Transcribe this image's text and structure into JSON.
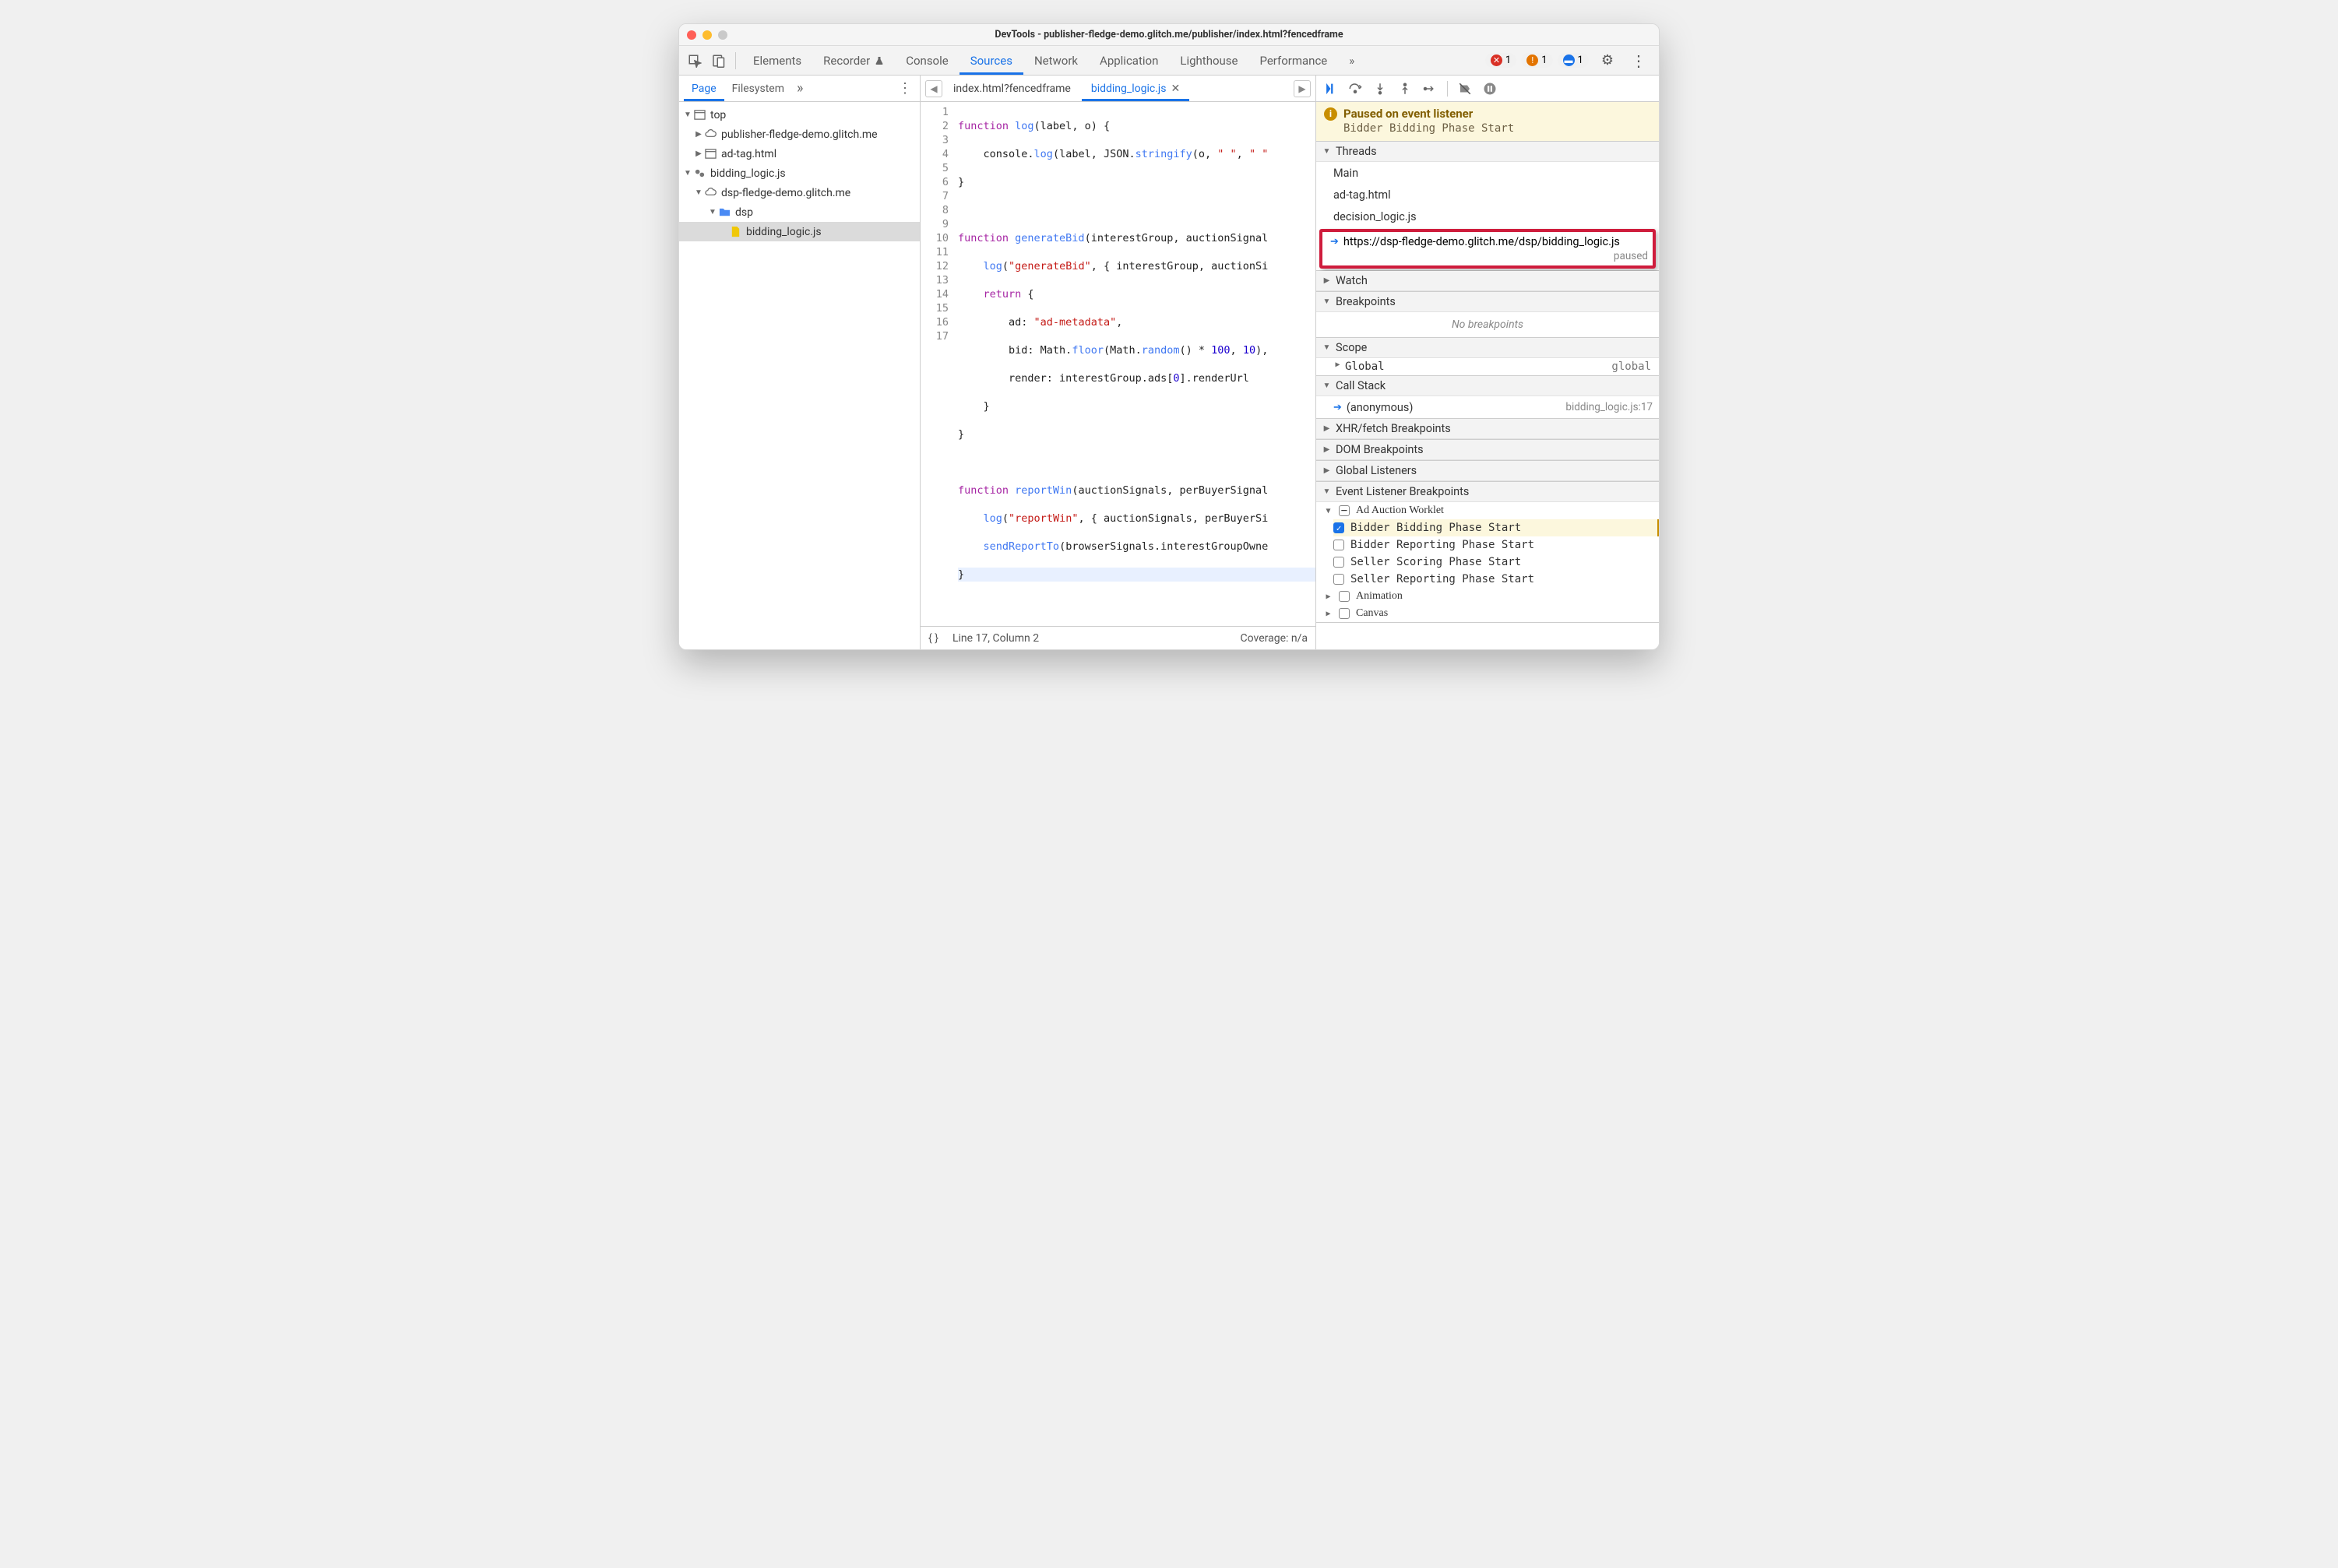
{
  "title": "DevTools - publisher-fledge-demo.glitch.me/publisher/index.html?fencedframe",
  "main_tabs": [
    "Elements",
    "Recorder",
    "Console",
    "Sources",
    "Network",
    "Application",
    "Lighthouse",
    "Performance"
  ],
  "main_active": "Sources",
  "counts": {
    "errors": "1",
    "warnings": "1",
    "messages": "1"
  },
  "left_tabs": [
    "Page",
    "Filesystem"
  ],
  "left_active": "Page",
  "tree": {
    "top": "top",
    "pub": "publisher-fledge-demo.glitch.me",
    "adtag": "ad-tag.html",
    "bidding": "bidding_logic.js",
    "dspcloud": "dsp-fledge-demo.glitch.me",
    "dspfolder": "dsp",
    "bidfile": "bidding_logic.js"
  },
  "file_tabs": [
    "index.html?fencedframe",
    "bidding_logic.js"
  ],
  "file_active": "bidding_logic.js",
  "code": {
    "l1": {
      "a": "function ",
      "b": "log",
      "c": "(label, o) {"
    },
    "l2": {
      "a": "    console.",
      "b": "log",
      "c": "(label, JSON.",
      "d": "stringify",
      "e": "(o, ",
      "f": "\" \"",
      "g": ", ",
      "h": "\" \""
    },
    "l3": "}",
    "l5": {
      "a": "function ",
      "b": "generateBid",
      "c": "(interestGroup, auctionSignal"
    },
    "l6": {
      "a": "    ",
      "b": "log",
      "c": "(",
      "d": "\"generateBid\"",
      "e": ", { interestGroup, auctionSi"
    },
    "l7": {
      "a": "    ",
      "b": "return ",
      "c": "{"
    },
    "l8": {
      "a": "        ad: ",
      "b": "\"ad-metadata\"",
      "c": ","
    },
    "l9": {
      "a": "        bid: Math.",
      "b": "floor",
      "c": "(Math.",
      "d": "random",
      "e": "() * ",
      "f": "100",
      "g": ", ",
      "h": "10",
      "i": "),"
    },
    "l10": {
      "a": "        render: interestGroup.ads[",
      "b": "0",
      "c": "].renderUrl"
    },
    "l11": "    }",
    "l12": "}",
    "l14": {
      "a": "function ",
      "b": "reportWin",
      "c": "(auctionSignals, perBuyerSignal"
    },
    "l15": {
      "a": "    ",
      "b": "log",
      "c": "(",
      "d": "\"reportWin\"",
      "e": ", { auctionSignals, perBuyerSi"
    },
    "l16": {
      "a": "    ",
      "b": "sendReportTo",
      "c": "(browserSignals.interestGroupOwne"
    },
    "l17": "}"
  },
  "status": {
    "line": "Line 17, Column 2",
    "coverage": "Coverage: n/a"
  },
  "paused": {
    "title": "Paused on event listener",
    "sub": "Bidder Bidding Phase Start"
  },
  "threads": {
    "header": "Threads",
    "items": [
      "Main",
      "ad-tag.html",
      "decision_logic.js"
    ],
    "current": "https://dsp-fledge-demo.glitch.me/dsp/bidding_logic.js",
    "paused": "paused"
  },
  "panels": {
    "watch": "Watch",
    "breakpoints": "Breakpoints",
    "no_bp": "No breakpoints",
    "scope": "Scope",
    "global": "Global",
    "global_val": "global",
    "callstack": "Call Stack",
    "cs_anon": "(anonymous)",
    "cs_loc": "bidding_logic.js:17",
    "xhr": "XHR/fetch Breakpoints",
    "dom": "DOM Breakpoints",
    "globlist": "Global Listeners",
    "elb": "Event Listener Breakpoints",
    "adauction": "Ad Auction Worklet",
    "elb_items": [
      "Bidder Bidding Phase Start",
      "Bidder Reporting Phase Start",
      "Seller Scoring Phase Start",
      "Seller Reporting Phase Start"
    ],
    "animation": "Animation",
    "canvas": "Canvas"
  }
}
